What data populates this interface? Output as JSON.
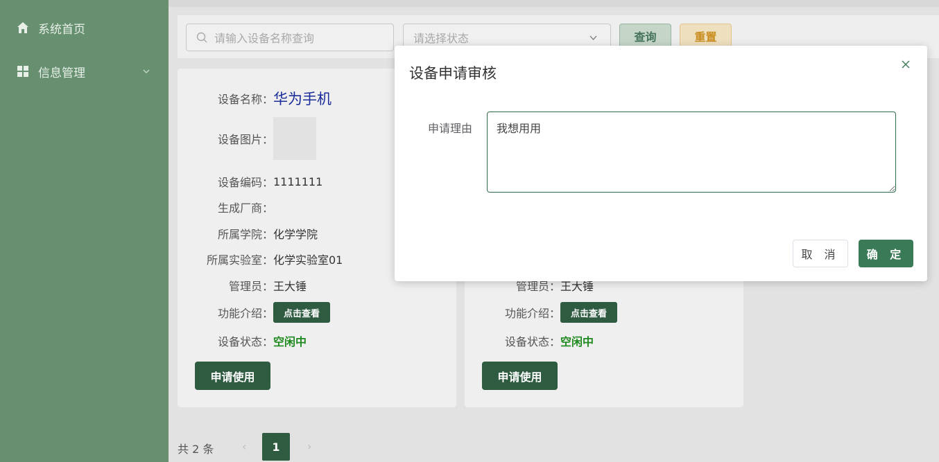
{
  "sidebar": {
    "items": [
      {
        "label": "系统首页",
        "icon": "home-icon"
      },
      {
        "label": "信息管理",
        "icon": "grid-icon"
      }
    ]
  },
  "toolbar": {
    "search_placeholder": "请输入设备名称查询",
    "status_placeholder": "请选择状态",
    "query_label": "查询",
    "reset_label": "重置"
  },
  "card_labels": {
    "name": "设备名称：",
    "image": "设备图片：",
    "code": "设备编码：",
    "maker": "生成厂商：",
    "college": "所属学院：",
    "lab": "所属实验室：",
    "admin": "管理员：",
    "intro": "功能介绍：",
    "status": "设备状态："
  },
  "cards": [
    {
      "name": "华为手机",
      "code": "1111111",
      "maker": "",
      "college": "化学学院",
      "lab": "化学实验室01",
      "admin": "王大锤",
      "intro_button": "点击查看",
      "status": "空闲中",
      "apply_button": "申请使用"
    },
    {
      "admin": "王大锤",
      "intro_button": "点击查看",
      "status": "空闲中",
      "apply_button": "申请使用"
    }
  ],
  "pagination": {
    "total": "共 2 条",
    "current": "1"
  },
  "dialog": {
    "title": "设备申请审核",
    "reason_label": "申请理由",
    "reason_value": "我想用用",
    "cancel_label": "取 消",
    "confirm_label": "确 定"
  },
  "colors": {
    "sidebar_bg": "#66906f",
    "primary": "#2f5b40",
    "status_green": "#1f8a1f",
    "title_blue": "#1a2b9a"
  }
}
